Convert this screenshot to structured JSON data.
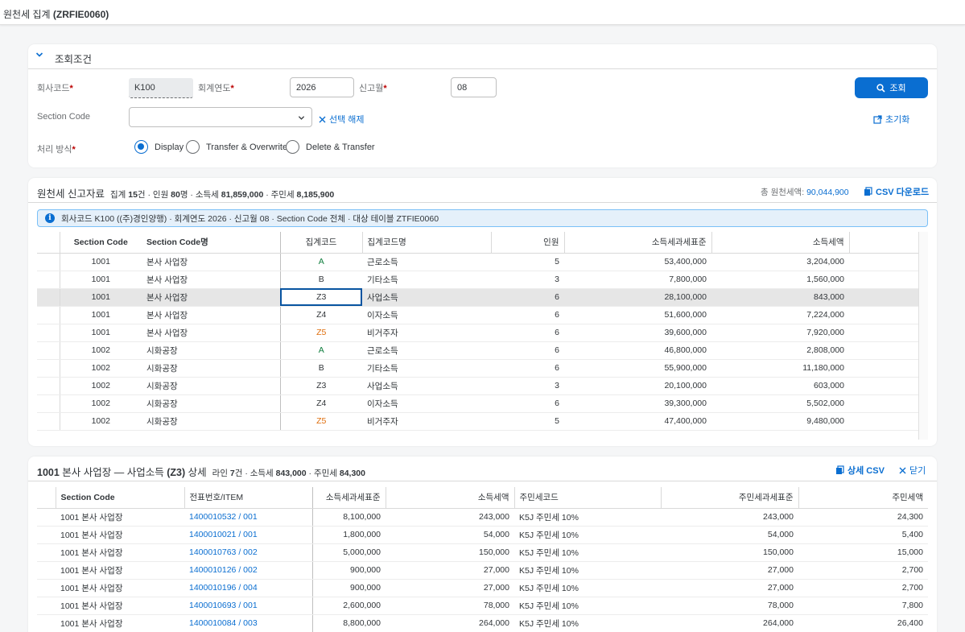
{
  "app": {
    "title_prefix": "원천세 집계",
    "title_code": "(ZRFIE0060)"
  },
  "filter": {
    "panel_title": "조회조건",
    "company_label": "회사코드",
    "company_value": "K100",
    "year_label": "회계연도",
    "year_value": "2026",
    "month_label": "신고월",
    "month_value": "08",
    "section_label": "Section Code",
    "section_value": "",
    "clear_label": "선택 해제",
    "mode_label": "처리 방식",
    "modes": [
      {
        "label": "Display",
        "selected": true
      },
      {
        "label": "Transfer & Overwrite",
        "selected": false
      },
      {
        "label": "Delete & Transfer",
        "selected": false
      }
    ],
    "search_label": "조회",
    "reset_label": "초기화"
  },
  "summary": {
    "title": "원천세 신고자료",
    "stat_count_label": "집계",
    "stat_count": "15",
    "stat_count_unit": "건 · 인원",
    "stat_people": "80",
    "stat_people_unit": "명 · 소득세",
    "stat_income_tax": "81,859,000",
    "stat_local_label": " · 주민세",
    "stat_local_tax": "8,185,900",
    "total_label": "총 원천세액:",
    "total_value": "90,044,900",
    "csv_label": "CSV 다운로드",
    "message": "회사코드 K100 ((주)경인양행) · 회계연도 2026 · 신고월 08 · Section Code 전체 · 대상 테이블 ZTFIE0060",
    "columns": [
      "Section Code",
      "Section Code명",
      "집계코드",
      "집계코드명",
      "인원",
      "소득세과세표준",
      "소득세액"
    ],
    "rows": [
      {
        "section": "1001",
        "section_name": "본사 사업장",
        "code": "A",
        "code_name": "근로소득",
        "people": "5",
        "base": "53,400,000",
        "tax": "3,204,000"
      },
      {
        "section": "1001",
        "section_name": "본사 사업장",
        "code": "B",
        "code_name": "기타소득",
        "people": "3",
        "base": "7,800,000",
        "tax": "1,560,000"
      },
      {
        "section": "1001",
        "section_name": "본사 사업장",
        "code": "Z3",
        "code_name": "사업소득",
        "people": "6",
        "base": "28,100,000",
        "tax": "843,000"
      },
      {
        "section": "1001",
        "section_name": "본사 사업장",
        "code": "Z4",
        "code_name": "이자소득",
        "people": "6",
        "base": "51,600,000",
        "tax": "7,224,000"
      },
      {
        "section": "1001",
        "section_name": "본사 사업장",
        "code": "Z5",
        "code_name": "비거주자",
        "people": "6",
        "base": "39,600,000",
        "tax": "7,920,000"
      },
      {
        "section": "1002",
        "section_name": "시화공장",
        "code": "A",
        "code_name": "근로소득",
        "people": "6",
        "base": "46,800,000",
        "tax": "2,808,000"
      },
      {
        "section": "1002",
        "section_name": "시화공장",
        "code": "B",
        "code_name": "기타소득",
        "people": "6",
        "base": "55,900,000",
        "tax": "11,180,000"
      },
      {
        "section": "1002",
        "section_name": "시화공장",
        "code": "Z3",
        "code_name": "사업소득",
        "people": "3",
        "base": "20,100,000",
        "tax": "603,000"
      },
      {
        "section": "1002",
        "section_name": "시화공장",
        "code": "Z4",
        "code_name": "이자소득",
        "people": "6",
        "base": "39,300,000",
        "tax": "5,502,000"
      },
      {
        "section": "1002",
        "section_name": "시화공장",
        "code": "Z5",
        "code_name": "비거주자",
        "people": "5",
        "base": "47,400,000",
        "tax": "9,480,000"
      }
    ],
    "selected_row": 2
  },
  "detail": {
    "title_bold1": "1001",
    "title_mid": "본사 사업장 —",
    "title_mid2": "사업소득",
    "title_bold2": "(Z3)",
    "title_suffix": "상세",
    "stat_label": "라인",
    "stat_lines": "7",
    "stat_lines_unit": "건 · 소득세",
    "stat_tax": "843,000",
    "stat_local_label": " · 주민세",
    "stat_local": "84,300",
    "csv_label": "상세 CSV",
    "close_label": "닫기",
    "columns": [
      "Section Code",
      "전표번호/ITEM",
      "소득세과세표준",
      "소득세액",
      "주민세코드",
      "주민세과세표준",
      "주민세액"
    ],
    "rows": [
      {
        "section": "1001 본사 사업장",
        "doc": "1400010532 / 001",
        "base": "8,100,000",
        "tax": "243,000",
        "lcode": "K5J 주민세 10%",
        "lbase": "243,000",
        "ltax": "24,300"
      },
      {
        "section": "1001 본사 사업장",
        "doc": "1400010021 / 001",
        "base": "1,800,000",
        "tax": "54,000",
        "lcode": "K5J 주민세 10%",
        "lbase": "54,000",
        "ltax": "5,400"
      },
      {
        "section": "1001 본사 사업장",
        "doc": "1400010763 / 002",
        "base": "5,000,000",
        "tax": "150,000",
        "lcode": "K5J 주민세 10%",
        "lbase": "150,000",
        "ltax": "15,000"
      },
      {
        "section": "1001 본사 사업장",
        "doc": "1400010126 / 002",
        "base": "900,000",
        "tax": "27,000",
        "lcode": "K5J 주민세 10%",
        "lbase": "27,000",
        "ltax": "2,700"
      },
      {
        "section": "1001 본사 사업장",
        "doc": "1400010196 / 004",
        "base": "900,000",
        "tax": "27,000",
        "lcode": "K5J 주민세 10%",
        "lbase": "27,000",
        "ltax": "2,700"
      },
      {
        "section": "1001 본사 사업장",
        "doc": "1400010693 / 001",
        "base": "2,600,000",
        "tax": "78,000",
        "lcode": "K5J 주민세 10%",
        "lbase": "78,000",
        "ltax": "7,800"
      },
      {
        "section": "1001 본사 사업장",
        "doc": "1400010084 / 003",
        "base": "8,800,000",
        "tax": "264,000",
        "lcode": "K5J 주민세 10%",
        "lbase": "264,000",
        "ltax": "26,400"
      }
    ]
  },
  "colors": {
    "accent": "#0a6ed1",
    "code_A": "#107e3e",
    "code_Z5": "#df6e0c",
    "required": "#bb0000"
  }
}
